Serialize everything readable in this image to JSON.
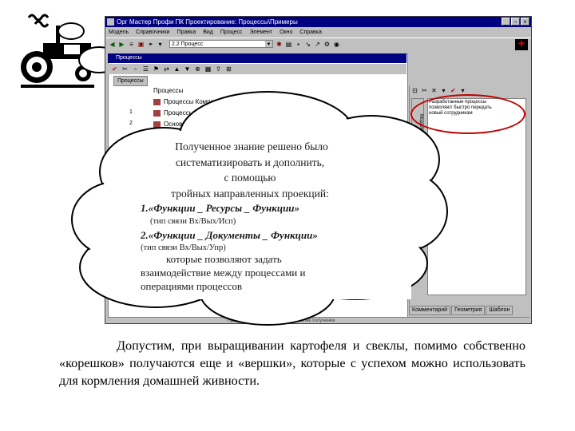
{
  "window": {
    "title": "Орг Мастер Профи ПК Проектирование: Процессы\\Примеры",
    "controls": [
      "_",
      "▫",
      "×"
    ],
    "menu": [
      "Модель",
      "Справочники",
      "Правка",
      "Вид",
      "Процесс",
      "Элемент",
      "Окно",
      "Справка"
    ],
    "process_combo": "2.2 Процесс",
    "inner_title": "Процессы",
    "nav_tab": "Процессы",
    "tree_items": [
      "Процессы",
      "Процессы Компании",
      "Процессы управления опер",
      "Основные"
    ],
    "tree_numbers": [
      "1",
      "2"
    ],
    "comment_text": "Разработанные процессы позволяют быстро передать новый сотрудникам",
    "bottom_tabs": [
      "Комментарий",
      "Геометрия",
      "Шаблон"
    ],
    "vertical_tab": "Модель",
    "status_text": "Процесс оформления документов на получение"
  },
  "cloud": {
    "line1": "Полученное знание решено было",
    "line2": "систематизировать и дополнить,",
    "line3": "с помощью",
    "line4": "тройных направленных проекций:",
    "item1": "1.«Функции _ Ресурсы _ Функции»",
    "item1_note": "(тип связи Вх/Вых/Исп)",
    "item2": "2.«Функции _ Документы _ Функции»",
    "item2_note": "(тип связи Вх/Вых/Упр)",
    "line5": "которые позволяют задать",
    "line6": "взаимодействие между процессами и",
    "line7": "операциями процессов"
  },
  "paragraph": "Допустим, при выращивании картофеля и свеклы, помимо собственно «корешков» получаются еще и «вершки», которые с успехом можно использовать для кормления домашней живности.",
  "colors": {
    "title_bar": "#000080",
    "highlight_ring": "#c00000",
    "window_bg": "#c0c0c0"
  }
}
